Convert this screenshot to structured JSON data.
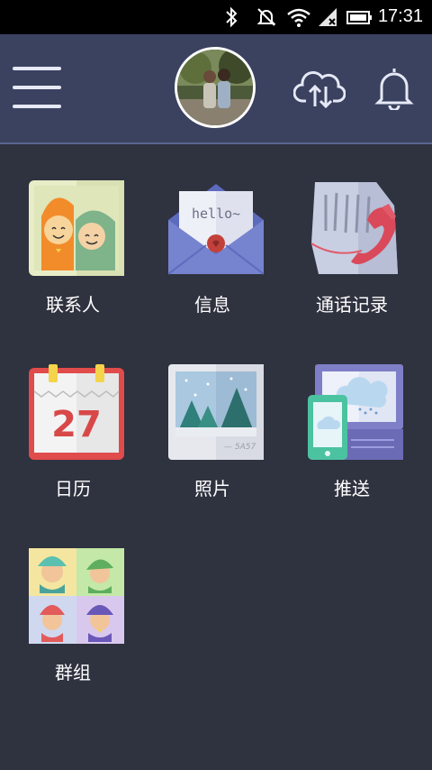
{
  "status_bar": {
    "time": "17:31"
  },
  "header": {
    "menu_icon": "hamburger-menu-icon",
    "avatar": "profile-photo",
    "cloud_icon": "cloud-sync-icon",
    "bell_icon": "notification-bell-icon"
  },
  "apps": [
    {
      "label": "联系人",
      "icon": "contacts-icon"
    },
    {
      "label": "信息",
      "icon": "message-envelope-icon"
    },
    {
      "label": "通话记录",
      "icon": "call-log-phone-icon"
    },
    {
      "label": "日历",
      "icon": "calendar-icon"
    },
    {
      "label": "照片",
      "icon": "photo-icon"
    },
    {
      "label": "推送",
      "icon": "push-devices-icon"
    },
    {
      "label": "群组",
      "icon": "group-icon"
    }
  ],
  "calendar_day": "27",
  "envelope_text": "hello~",
  "colors": {
    "header_bg": "#3b4260",
    "body_bg": "#2f323f",
    "accent": "#5b6790"
  }
}
